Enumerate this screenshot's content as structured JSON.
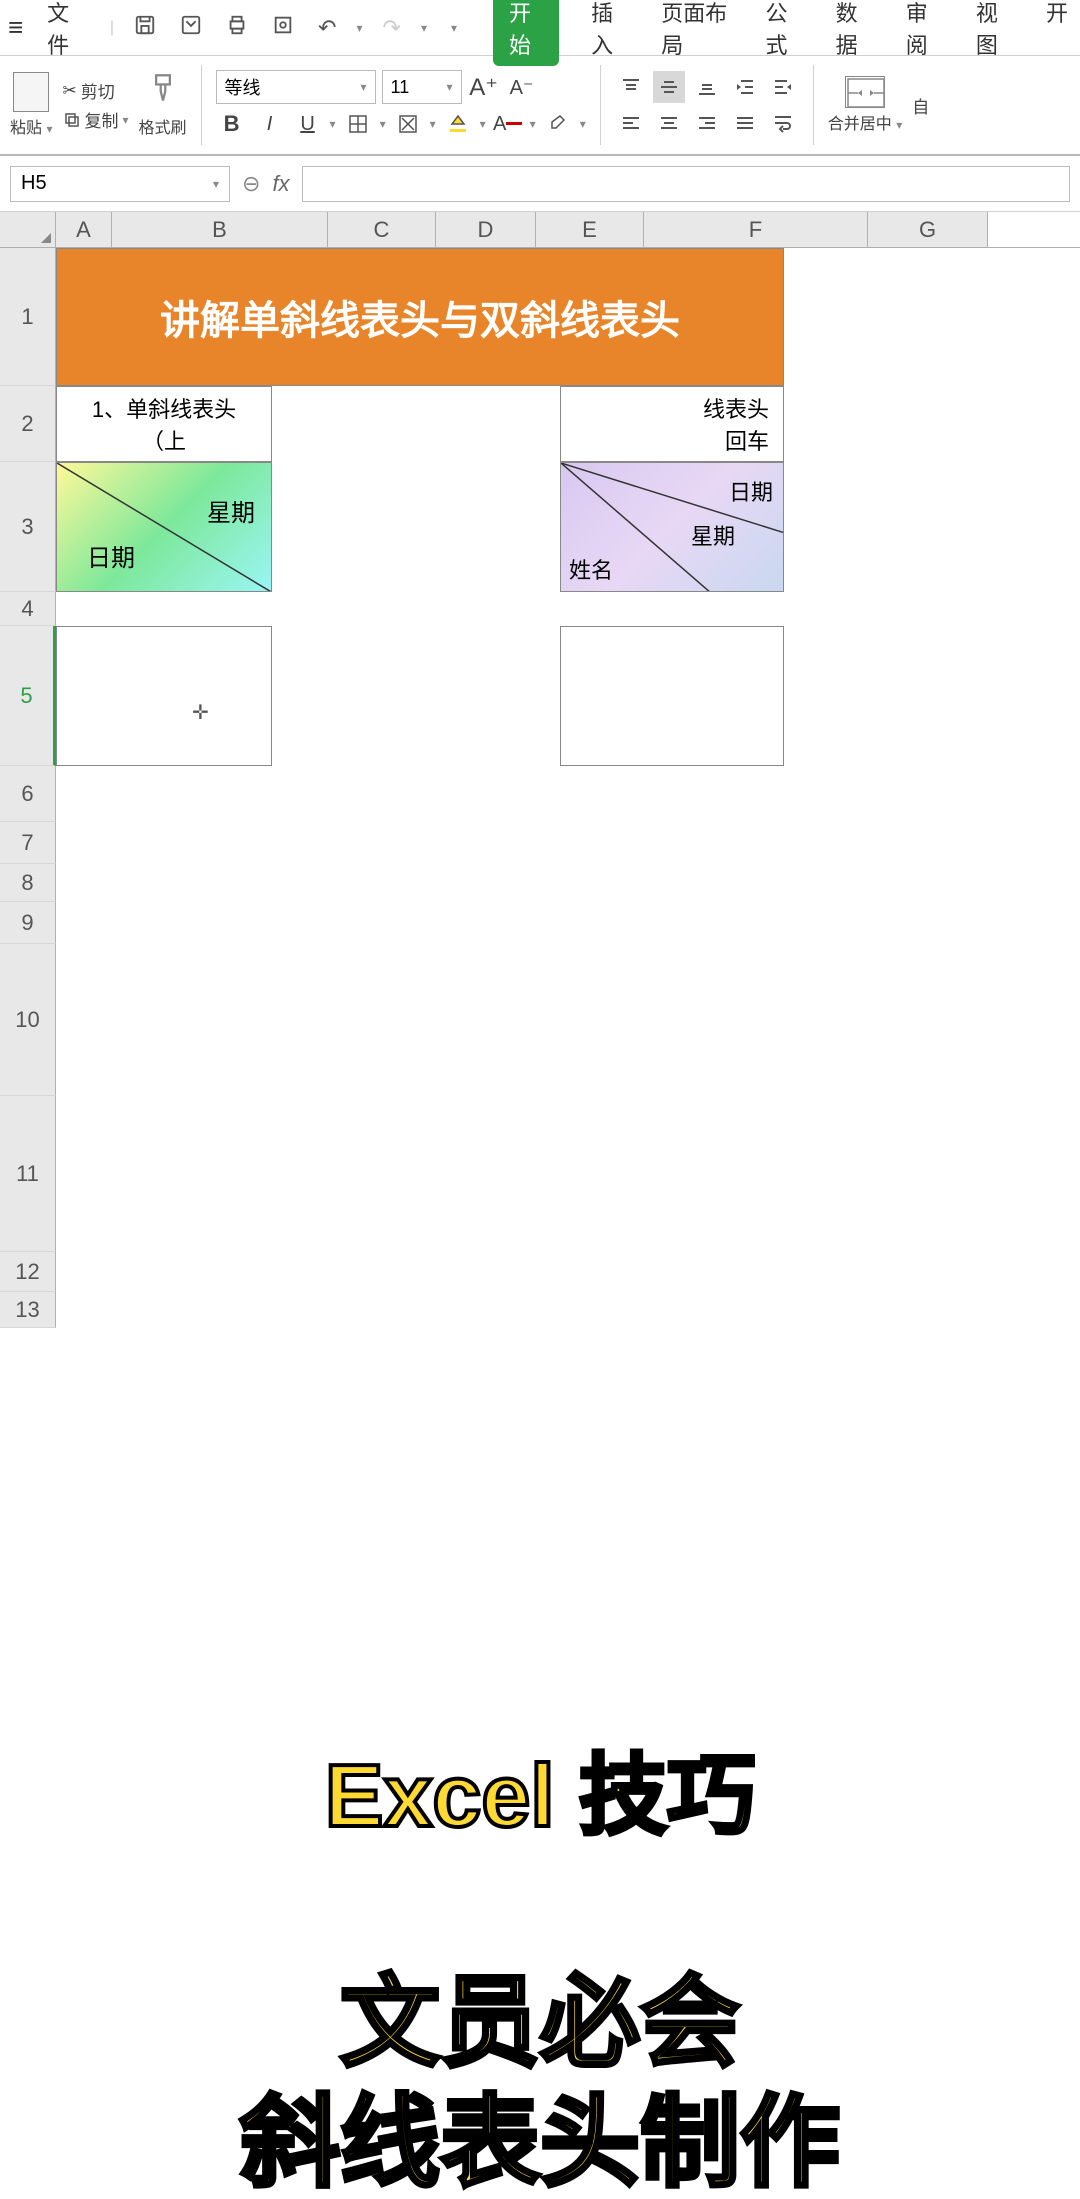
{
  "menubar": {
    "file_label": "文件",
    "tabs": {
      "start": "开始",
      "insert": "插入",
      "layout": "页面布局",
      "formula": "公式",
      "data": "数据",
      "review": "审阅",
      "view": "视图",
      "dev": "开"
    }
  },
  "ribbon": {
    "paste": "粘贴",
    "cut": "剪切",
    "copy": "复制",
    "format_painter": "格式刷",
    "font_name": "等线",
    "font_size": "11",
    "merge": "合并居中",
    "auto": "自"
  },
  "formula_bar": {
    "cell_ref": "H5",
    "fx": "fx"
  },
  "columns": [
    "A",
    "B",
    "C",
    "D",
    "E",
    "F",
    "G"
  ],
  "rows": [
    "1",
    "2",
    "3",
    "4",
    "5",
    "6",
    "7",
    "8",
    "9",
    "10",
    "11",
    "12",
    "13"
  ],
  "content": {
    "title": "讲解单斜线表头与双斜线表头",
    "sub1_line1": "1、单斜线表头",
    "sub1_line2": "（上",
    "sub2_line1": "线表头",
    "sub2_line2": "回车",
    "diag1_weekday": "星期",
    "diag1_date": "日期",
    "diag2_date": "日期",
    "diag2_weekday": "星期",
    "diag2_name": "姓名"
  },
  "overlay": {
    "line1": "Excel 技巧",
    "line2": "文员必会",
    "line3": "斜线表头制作"
  }
}
